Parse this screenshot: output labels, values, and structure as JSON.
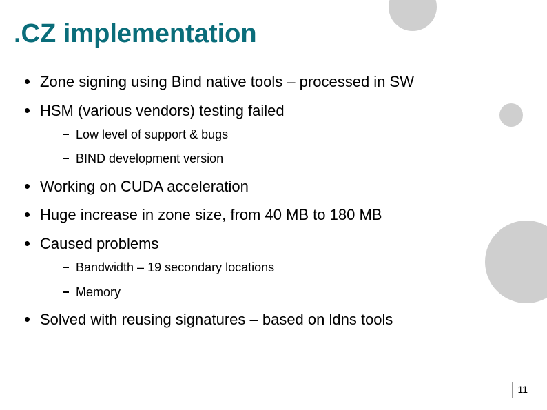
{
  "title": ".CZ implementation",
  "bullets": {
    "b0": "Zone signing using Bind native tools – processed in SW",
    "b1": "HSM (various vendors) testing failed",
    "b1_sub": {
      "s0": "Low level of support & bugs",
      "s1": "BIND development version"
    },
    "b2": "Working on CUDA acceleration",
    "b3": "Huge increase in zone size, from 40 MB  to 180 MB",
    "b4": "Caused problems",
    "b4_sub": {
      "s0": "Bandwidth – 19 secondary locations",
      "s1": "Memory"
    },
    "b5": "Solved with reusing signatures – based on ldns tools"
  },
  "page_number": "11"
}
